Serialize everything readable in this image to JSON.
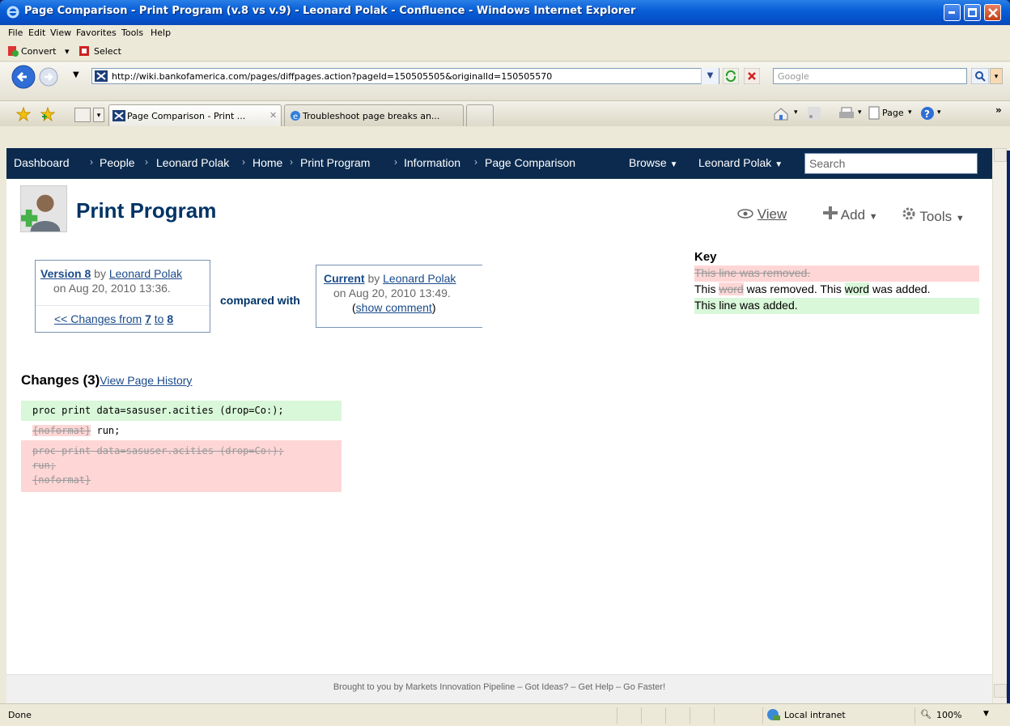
{
  "window": {
    "title": "Page Comparison - Print Program (v.8 vs v.9) - Leonard Polak - Confluence - Windows Internet Explorer"
  },
  "menu": [
    "File",
    "Edit",
    "View",
    "Favorites",
    "Tools",
    "Help"
  ],
  "toolbar": {
    "convert_label": "Convert",
    "select_label": "Select"
  },
  "address": {
    "url": "http://wiki.bankofamerica.com/pages/diffpages.action?pageId=150505505&originalId=150505570",
    "search_placeholder": "Google"
  },
  "tabs": [
    {
      "label": "Page Comparison - Print ..."
    },
    {
      "label": "Troubleshoot page breaks an..."
    }
  ],
  "command_bar": {
    "page_label": "Page"
  },
  "confluence_nav": {
    "breadcrumbs": [
      "Dashboard",
      "People",
      "Leonard Polak",
      "Home",
      "Print Program",
      "Information",
      "Page Comparison"
    ],
    "browse_label": "Browse",
    "user_label": "Leonard Polak",
    "search_placeholder": "Search"
  },
  "page": {
    "title": "Print Program",
    "actions": {
      "view": "View",
      "add": "Add",
      "tools": "Tools"
    }
  },
  "version_left": {
    "version_link": "Version 8",
    "by": "by",
    "author": "Leonard Polak",
    "date": "on Aug 20, 2010 13:36.",
    "changes_link_prefix": "<< Changes from",
    "from": "7",
    "to_word": "to",
    "to": "8"
  },
  "compared_with": "compared with",
  "version_right": {
    "version_link": "Current",
    "by": "by",
    "author": "Leonard Polak",
    "date": "on Aug 20, 2010 13:49.",
    "show_comment_open": "(",
    "show_comment": "show comment",
    "show_comment_close": ")"
  },
  "key": {
    "heading": "Key",
    "removed_line": "This line was removed.",
    "word_prefix": "This",
    "word_removed": "word",
    "word_middle": "was removed. This",
    "word_added": "word",
    "word_suffix": "was added.",
    "added_line": "This line was added.",
    "colors": {
      "removed_bg": "#ffd6d6",
      "added_bg": "#d9f7d9"
    }
  },
  "changes": {
    "heading": "Changes (3)",
    "history_link": "View Page History"
  },
  "diff": {
    "added_line": "proc print data=sasuser.acities (drop=Co:);",
    "mixed_removed": "{noformat}",
    "mixed_text": "run;",
    "removed_lines": [
      "proc print data=sasuser.acities (drop=Co:);",
      "run;",
      "{noformat}"
    ]
  },
  "footer": {
    "text": "Brought to you by Markets Innovation Pipeline – Got Ideas? – Get Help – Go Faster!"
  },
  "status": {
    "left": "Done",
    "zone": "Local intranet",
    "zoom": "100%"
  }
}
